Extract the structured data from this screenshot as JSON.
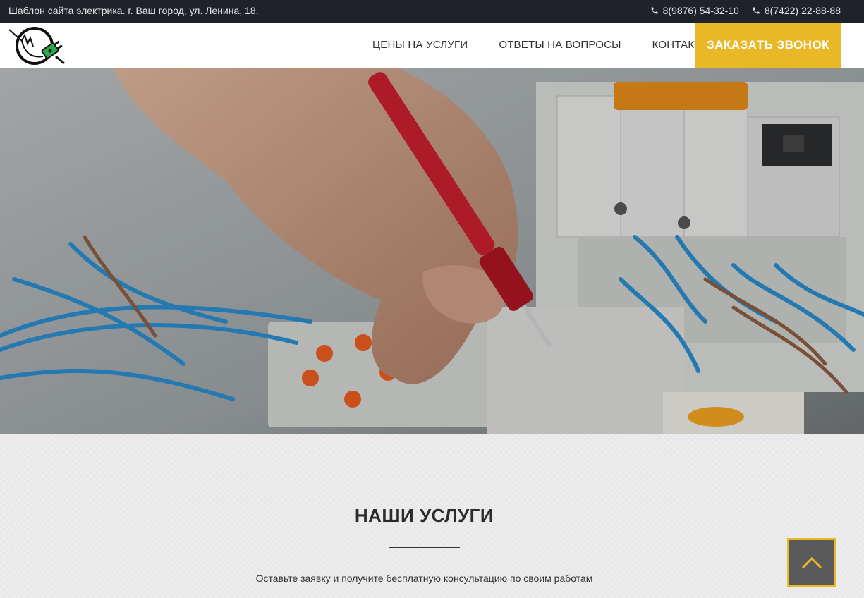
{
  "topbar": {
    "address": "Шаблон сайта электрика. г. Ваш город, ул. Ленина, 18.",
    "phones": [
      "8(9876) 54-32-10",
      "8(7422) 22-88-88"
    ]
  },
  "nav": {
    "items": [
      "ЦЕНЫ НА УСЛУГИ",
      "ОТВЕТЫ НА ВОПРОСЫ",
      "КОНТАКТЫ"
    ],
    "cta_label": "ЗАКАЗАТЬ ЗВОНОК"
  },
  "hero": {
    "slides_count": 3,
    "active_slide": 1
  },
  "services": {
    "title": "НАШИ УСЛУГИ",
    "subtitle": "Оставьте заявку и получите бесплатную консультацию по своим работам"
  },
  "colors": {
    "accent": "#e8b826",
    "topbar": "#1f2329",
    "text": "#333333"
  },
  "icons": {
    "phone": "phone-icon",
    "logo": "plug-logo-icon",
    "scroll_top": "chevron-up-icon"
  }
}
